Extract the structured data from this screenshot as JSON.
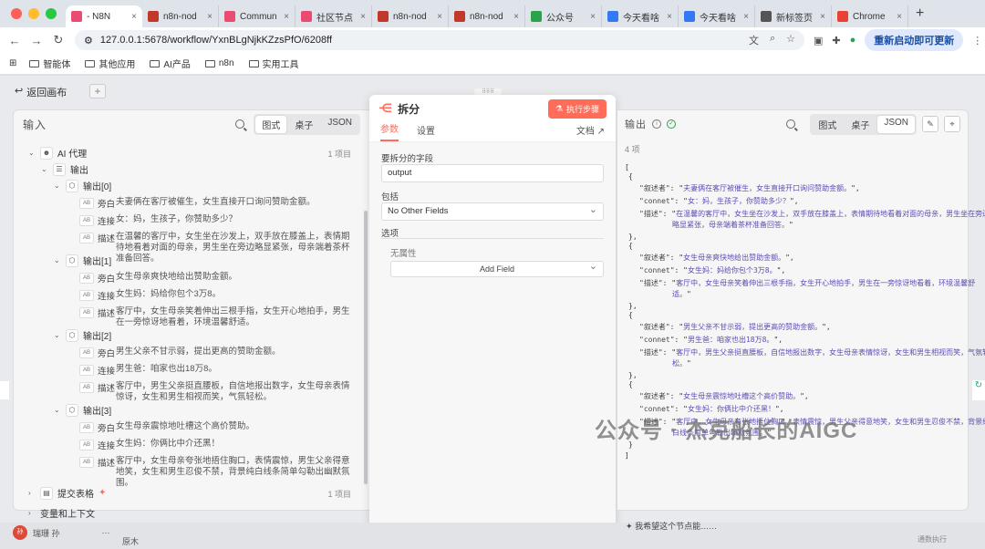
{
  "browser": {
    "tabs": [
      {
        "label": "- N8N",
        "color": "#ea4b71",
        "active": true
      },
      {
        "label": "n8n-nod",
        "color": "#c0392b"
      },
      {
        "label": "Commun",
        "color": "#ea4b71"
      },
      {
        "label": "社区节点",
        "color": "#ea4b71"
      },
      {
        "label": "n8n-nod",
        "color": "#c0392b"
      },
      {
        "label": "n8n-nod",
        "color": "#c0392b"
      },
      {
        "label": "公众号",
        "color": "#2aa34a"
      },
      {
        "label": "今天看啥",
        "color": "#3478f6"
      },
      {
        "label": "今天看啥",
        "color": "#3478f6"
      },
      {
        "label": "新标签页",
        "color": "#555555"
      },
      {
        "label": "Chrome",
        "color": "#e94235"
      }
    ],
    "url": "127.0.0.1:5678/workflow/YxnBLgNjkKZzsPfO/6208ff",
    "restart_label": "重新启动即可更新",
    "bookmarks": [
      "智能体",
      "其他应用",
      "AI产品",
      "n8n",
      "实用工具"
    ]
  },
  "canvas": {
    "back_label": "返回画布",
    "add_label": "+"
  },
  "input": {
    "title": "输入",
    "views": [
      "图式",
      "桌子",
      "JSON"
    ],
    "node_name": "AI 代理",
    "node_count": "1 项目",
    "output_label": "输出",
    "groups": [
      {
        "label": "输出[0]",
        "fields": [
          {
            "key": "旁白",
            "value": "夫妻俩在客厅被催生，女生直接开口询问赞助金额。"
          },
          {
            "key": "连接",
            "value": "女：妈，生孩子，你赞助多少？"
          },
          {
            "key": "描述",
            "value": "在温馨的客厅中，女生坐在沙发上，双手放在膝盖上，表情期待地看着对面的母亲，男生坐在旁边略显紧张，母亲端着茶杯准备回答。"
          }
        ]
      },
      {
        "label": "输出[1]",
        "fields": [
          {
            "key": "旁白",
            "value": "女生母亲爽快地给出赞助金额。"
          },
          {
            "key": "连接",
            "value": "女生妈：妈给你包个3万8。"
          },
          {
            "key": "描述",
            "value": "客厅中，女生母亲笑着伸出三根手指，女生开心地拍手，男生在一旁惊讶地看着，环境温馨舒适。"
          }
        ]
      },
      {
        "label": "输出[2]",
        "fields": [
          {
            "key": "旁白",
            "value": "男生父亲不甘示弱，提出更高的赞助金额。"
          },
          {
            "key": "连接",
            "value": "男生爸：咱家也出18万8。"
          },
          {
            "key": "描述",
            "value": "客厅中，男生父亲挺直腰板，自信地报出数字，女生母亲表情惊讶，女生和男生相视而笑，气氛轻松。"
          }
        ]
      },
      {
        "label": "输出[3]",
        "fields": [
          {
            "key": "旁白",
            "value": "女生母亲震惊地吐槽这个高价赞助。"
          },
          {
            "key": "连接",
            "value": "女生妈：你俩比中介还黑！"
          },
          {
            "key": "描述",
            "value": "客厅中，女生母亲夸张地捂住胸口，表情震惊，男生父亲得意地笑，女生和男生忍俊不禁，背景纯白线条简单勾勒出幽默氛围。"
          }
        ]
      }
    ],
    "submit_node": "提交表格",
    "submit_count": "1 项目",
    "context_label": "变量和上下文"
  },
  "modal": {
    "title": "拆分",
    "exec_label": "执行步骤",
    "tabs": [
      "参数",
      "设置"
    ],
    "doc_label": "文档",
    "field_label": "要拆分的字段",
    "field_value": "output",
    "include_label": "包括",
    "include_value": "No Other Fields",
    "options_label": "选项",
    "no_props": "无属性",
    "add_field": "Add Field"
  },
  "output": {
    "title": "输出",
    "views": [
      "图式",
      "桌子",
      "JSON"
    ],
    "items_count": "4 项",
    "records": [
      {
        "narr": "夫妻俩在客厅被催生，女生直接开口询问赞助金额。",
        "connet": "女：妈，生孩子，你赞助多少？",
        "desc": "在温馨的客厅中，女生坐在沙发上，双手放在膝盖上，表情期待地看着对面的母亲，男生坐在旁边",
        "desc2": "略显紧张，母亲端着茶杯准备回答。"
      },
      {
        "narr": "女生母亲爽快地给出赞助金额。",
        "connet": "女生妈：妈给你包个3万8。",
        "desc": "客厅中，女生母亲笑着伸出三根手指，女生开心地拍手，男生在一旁惊讶地看着，环境温馨舒",
        "desc2": "适。"
      },
      {
        "narr": "男生父亲不甘示弱，提出更高的赞助金额。",
        "connet": "男生爸：咱家也出18万8。",
        "desc": "客厅中，男生父亲挺直腰板，自信地报出数字，女生母亲表情惊讶，女生和男生相视而笑，气氛轻",
        "desc2": "松。"
      },
      {
        "narr": "女生母亲震惊地吐槽这个高价赞助。",
        "connet": "女生妈：你俩比中介还黑！",
        "desc": "客厅中，女生母亲夸张地捂住胸口，表情震惊，男生父亲得意地笑，女生和男生忍俊不禁，背景纯",
        "desc2": "白线条简单勾勒出幽默氛围。"
      }
    ],
    "key_narr": "\"叙述者\"",
    "key_connet": "\"connet\"",
    "key_desc": "\"描述\""
  },
  "footer": {
    "user": "瑞珊 孙",
    "log": "原木",
    "hint": "我希望这个节点能……",
    "hint_right": "通数执行"
  },
  "watermark": "公众号 · 杰克船长的AIGC"
}
